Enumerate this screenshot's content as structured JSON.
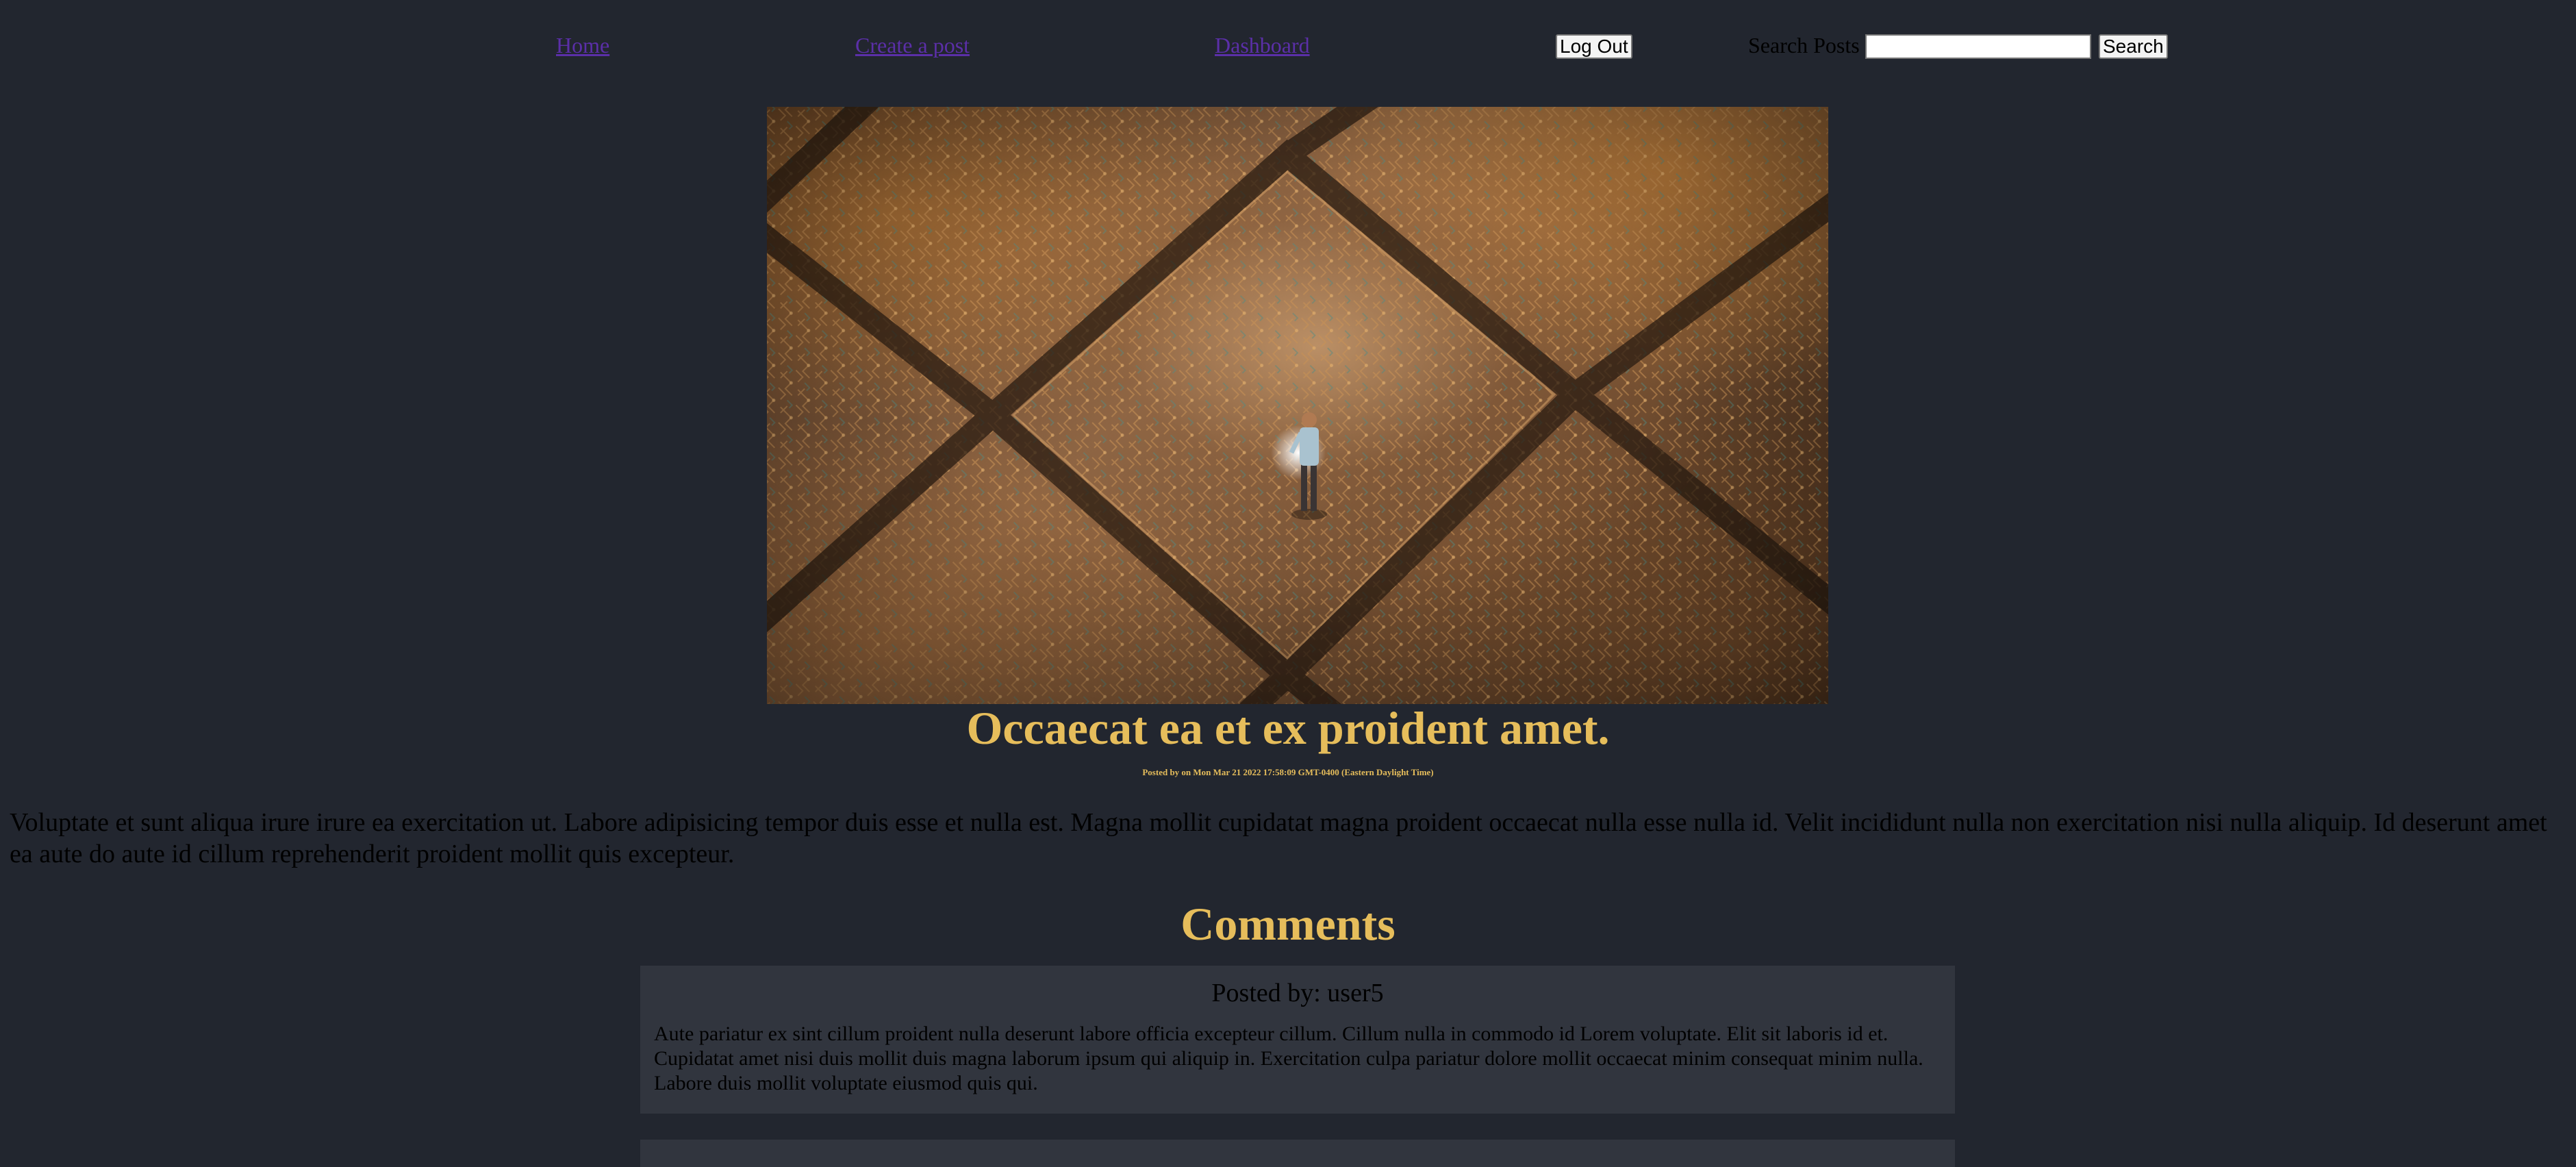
{
  "nav": {
    "home_label": "Home",
    "create_label": "Create a post",
    "dashboard_label": "Dashboard",
    "logout_label": "Log Out",
    "search_label": "Search Posts",
    "search_value": "",
    "search_button_label": "Search"
  },
  "post": {
    "image_subject": "miniature figure standing on circuit board",
    "title": "Occaecat ea et ex proident amet.",
    "meta": "Posted by on Mon Mar 21 2022 17:58:09 GMT-0400 (Eastern Daylight Time)",
    "body": "Voluptate et sunt aliqua irure irure ea exercitation ut. Labore adipisicing tempor duis esse et nulla est. Magna mollit cupidatat magna proident occaecat nulla esse nulla id. Velit incididunt nulla non exercitation nisi nulla aliquip. Id deserunt amet ea aute do aute id cillum reprehenderit proident mollit quis excepteur."
  },
  "comments": {
    "heading": "Comments",
    "items": [
      {
        "author": "Posted by: user5",
        "text": "Aute pariatur ex sint cillum proident nulla deserunt labore officia excepteur cillum. Cillum nulla in commodo id Lorem voluptate. Elit sit laboris id et. Cupidatat amet nisi duis mollit duis magna laborum ipsum qui aliquip in. Exercitation culpa pariatur dolore mollit occaecat minim consequat minim nulla. Labore duis mollit voluptate eiusmod quis qui."
      }
    ]
  },
  "colors": {
    "background": "#22262f",
    "accent": "#e6bd5b",
    "link": "#5b2fa8",
    "card": "#31353e"
  }
}
